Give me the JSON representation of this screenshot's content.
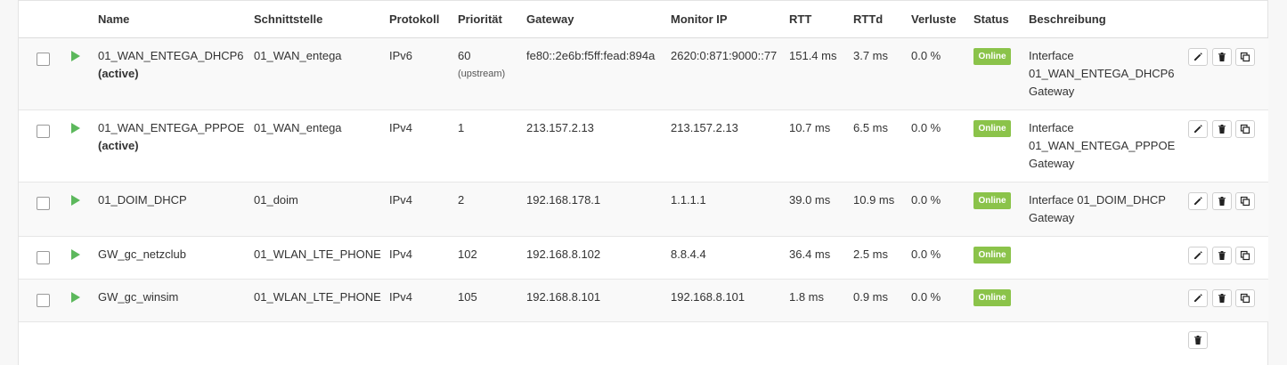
{
  "columns": {
    "name": "Name",
    "interface": "Schnittstelle",
    "protocol": "Protokoll",
    "priority": "Priorität",
    "gateway": "Gateway",
    "monitor_ip": "Monitor IP",
    "rtt": "RTT",
    "rttd": "RTTd",
    "loss": "Verluste",
    "status": "Status",
    "description": "Beschreibung"
  },
  "rows": [
    {
      "name": "01_WAN_ENTEGA_DHCP6",
      "active": "(active)",
      "interface": "01_WAN_entega",
      "protocol": "IPv6",
      "priority": "60",
      "priority_note": "(upstream)",
      "gateway": "fe80::2e6b:f5ff:fead:894a",
      "monitor_ip": "2620:0:871:9000::77",
      "rtt": "151.4 ms",
      "rttd": "3.7 ms",
      "loss": "0.0 %",
      "status": "Online",
      "description": [
        "Interface",
        "01_WAN_ENTEGA_DHCP6",
        "Gateway"
      ]
    },
    {
      "name": "01_WAN_ENTEGA_PPPOE",
      "active": "(active)",
      "interface": "01_WAN_entega",
      "protocol": "IPv4",
      "priority": "1",
      "priority_note": "",
      "gateway": "213.157.2.13",
      "monitor_ip": "213.157.2.13",
      "rtt": "10.7 ms",
      "rttd": "6.5 ms",
      "loss": "0.0 %",
      "status": "Online",
      "description": [
        "Interface",
        "01_WAN_ENTEGA_PPPOE",
        "Gateway"
      ]
    },
    {
      "name": "01_DOIM_DHCP",
      "active": "",
      "interface": "01_doim",
      "protocol": "IPv4",
      "priority": "2",
      "priority_note": "",
      "gateway": "192.168.178.1",
      "monitor_ip": "1.1.1.1",
      "rtt": "39.0 ms",
      "rttd": "10.9 ms",
      "loss": "0.0 %",
      "status": "Online",
      "description": [
        "Interface 01_DOIM_DHCP",
        "Gateway"
      ]
    },
    {
      "name": "GW_gc_netzclub",
      "active": "",
      "interface": "01_WLAN_LTE_PHONE",
      "protocol": "IPv4",
      "priority": "102",
      "priority_note": "",
      "gateway": "192.168.8.102",
      "monitor_ip": "8.8.4.4",
      "rtt": "36.4 ms",
      "rttd": "2.5 ms",
      "loss": "0.0 %",
      "status": "Online",
      "description": []
    },
    {
      "name": "GW_gc_winsim",
      "active": "",
      "interface": "01_WLAN_LTE_PHONE",
      "protocol": "IPv4",
      "priority": "105",
      "priority_note": "",
      "gateway": "192.168.8.101",
      "monitor_ip": "192.168.8.101",
      "rtt": "1.8 ms",
      "rttd": "0.9 ms",
      "loss": "0.0 %",
      "status": "Online",
      "description": []
    }
  ],
  "icons": {
    "play": "play-icon",
    "edit": "pencil-icon",
    "delete": "trash-icon",
    "clone": "copy-icon"
  },
  "colors": {
    "status_online": "#8bc34a",
    "play_green": "#5cb85c"
  }
}
